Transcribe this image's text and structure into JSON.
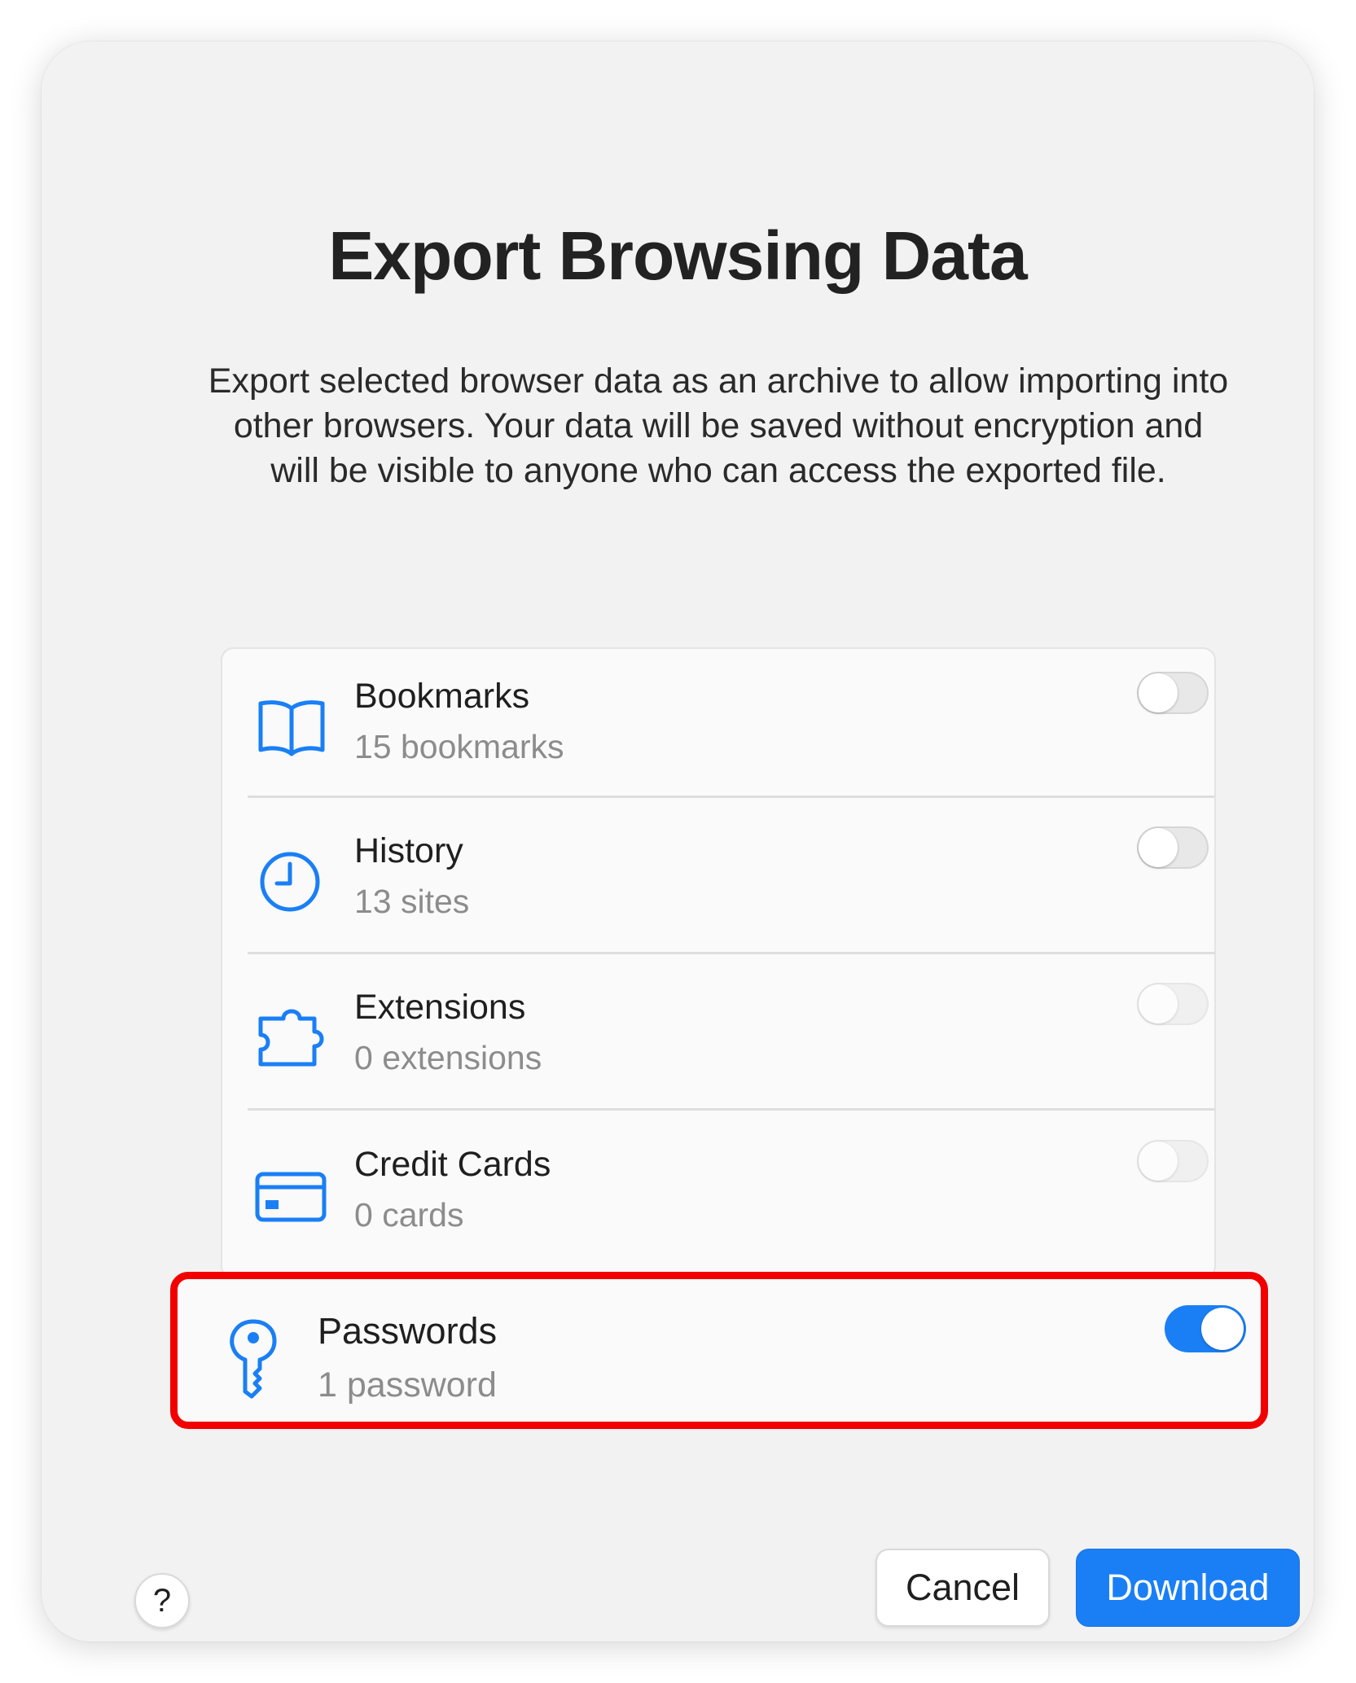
{
  "dialog": {
    "title": "Export Browsing Data",
    "description": "Export selected browser data as an archive to allow importing into other browsers. Your data will be saved without encryption and will be visible to anyone who can access the exported file."
  },
  "items": [
    {
      "title": "Bookmarks",
      "subtitle": "15 bookmarks",
      "icon": "book-icon",
      "enabled": false,
      "toggle_disabled": false
    },
    {
      "title": "History",
      "subtitle": "13 sites",
      "icon": "clock-icon",
      "enabled": false,
      "toggle_disabled": false
    },
    {
      "title": "Extensions",
      "subtitle": "0 extensions",
      "icon": "puzzle-icon",
      "enabled": false,
      "toggle_disabled": true
    },
    {
      "title": "Credit Cards",
      "subtitle": "0 cards",
      "icon": "credit-card-icon",
      "enabled": false,
      "toggle_disabled": true
    },
    {
      "title": "Passwords",
      "subtitle": "1 password",
      "icon": "key-icon",
      "enabled": true,
      "toggle_disabled": false
    }
  ],
  "buttons": {
    "help": "?",
    "cancel": "Cancel",
    "download": "Download"
  },
  "colors": {
    "accent": "#1a7ff5",
    "highlight_border": "#f20000",
    "icon": "#1a7ff5"
  }
}
